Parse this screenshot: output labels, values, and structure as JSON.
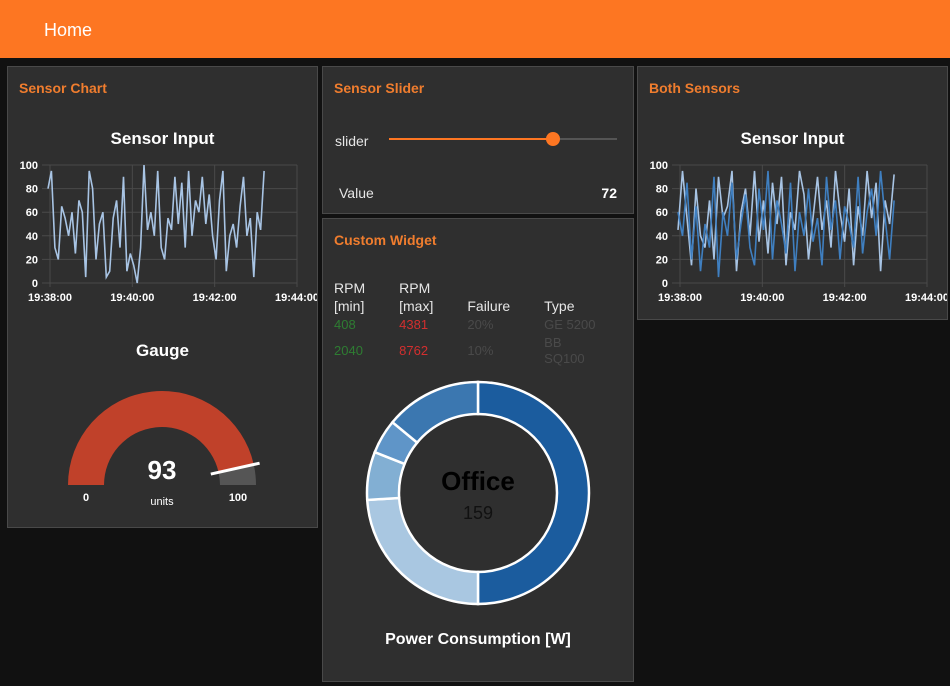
{
  "header": {
    "title": "Home"
  },
  "sensor_chart_card": {
    "title": "Sensor Chart"
  },
  "gauge": {
    "title": "Gauge",
    "value": "93",
    "units": "units",
    "min": "0",
    "max": "100",
    "fraction": 0.93
  },
  "sensor_slider_card": {
    "title": "Sensor Slider",
    "slider_label": "slider",
    "value_label": "Value",
    "value": "72",
    "fraction": 0.72
  },
  "custom_widget_card": {
    "title": "Custom Widget",
    "headers": [
      "RPM\n[min]",
      "RPM\n[max]",
      "Failure",
      "Type"
    ],
    "rows": [
      {
        "min": "408",
        "max": "4381",
        "failure": "20%",
        "type": "GE 5200"
      },
      {
        "min": "2040",
        "max": "8762",
        "failure": "10%",
        "type": "BB SQ100"
      }
    ],
    "donut": {
      "center_title": "Office",
      "center_value": "159",
      "label": "Power Consumption [W]"
    }
  },
  "both_sensors_card": {
    "title": "Both Sensors"
  },
  "colors": {
    "accent": "#fd7622",
    "gauge_fill": "#c0412a",
    "line_light": "#a8c4e4",
    "line_dark": "#3f7fc0"
  },
  "chart_data": [
    {
      "type": "line",
      "title": "Sensor Input",
      "x_ticks": [
        "19:38:00",
        "19:40:00",
        "19:42:00",
        "19:44:00"
      ],
      "y_ticks": [
        "0",
        "20",
        "40",
        "60",
        "80",
        "100"
      ],
      "ylim": [
        0,
        100
      ],
      "series": [
        {
          "values": [
            80,
            95,
            30,
            20,
            65,
            55,
            40,
            60,
            25,
            70,
            60,
            5,
            95,
            80,
            20,
            50,
            60,
            5,
            10,
            55,
            70,
            30,
            90,
            10,
            25,
            15,
            0,
            30,
            100,
            45,
            60,
            40,
            95,
            30,
            20,
            55,
            45,
            90,
            50,
            85,
            30,
            95,
            40,
            70,
            60,
            90,
            50,
            75,
            40,
            20,
            70,
            95,
            10,
            40,
            50,
            30,
            65,
            90,
            40,
            55,
            5,
            60,
            45,
            95
          ]
        }
      ]
    },
    {
      "type": "line",
      "title": "Sensor Input",
      "x_ticks": [
        "19:38:00",
        "19:40:00",
        "19:42:00",
        "19:44:00"
      ],
      "y_ticks": [
        "0",
        "20",
        "40",
        "60",
        "80",
        "100"
      ],
      "ylim": [
        0,
        100
      ],
      "series": [
        {
          "values": [
            45,
            95,
            55,
            15,
            80,
            40,
            30,
            70,
            20,
            90,
            55,
            65,
            95,
            10,
            60,
            80,
            40,
            95,
            35,
            70,
            25,
            85,
            50,
            90,
            15,
            60,
            45,
            95,
            75,
            20,
            55,
            90,
            45,
            70,
            30,
            95,
            60,
            35,
            80,
            15,
            65,
            40,
            95,
            55,
            85,
            10,
            70,
            50,
            92
          ]
        },
        {
          "values": [
            60,
            40,
            85,
            20,
            65,
            10,
            50,
            30,
            90,
            5,
            60,
            40,
            85,
            20,
            50,
            75,
            30,
            15,
            80,
            45,
            95,
            20,
            70,
            50,
            25,
            85,
            10,
            60,
            40,
            80,
            35,
            55,
            15,
            90,
            45,
            70,
            20,
            65,
            50,
            30,
            90,
            25,
            60,
            80,
            40,
            95,
            55,
            20,
            70
          ]
        }
      ]
    },
    {
      "type": "pie",
      "values": [
        50,
        24,
        7,
        5,
        14
      ],
      "colors": [
        "#1b5c9e",
        "#a9c7e1",
        "#82afd3",
        "#5f95c8",
        "#3b77b0"
      ]
    }
  ]
}
